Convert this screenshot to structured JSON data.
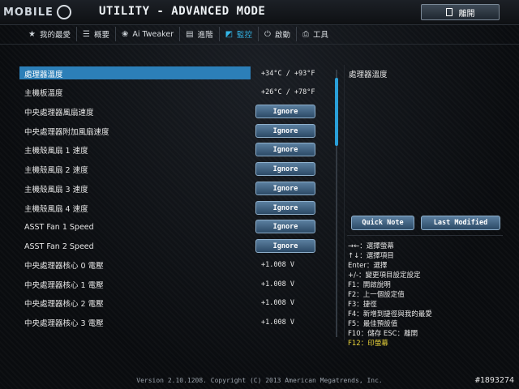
{
  "header": {
    "logo_text": "MOBILE",
    "title": "UTILITY - ADVANCED MODE",
    "exit_label": "離開"
  },
  "tabs": [
    {
      "icon": "star-icon",
      "glyph": "★",
      "label": "我的最愛",
      "active": false
    },
    {
      "icon": "list-icon",
      "glyph": "☰",
      "label": "概要",
      "active": false
    },
    {
      "icon": "tweaker-icon",
      "glyph": "❀",
      "label": "Ai Tweaker",
      "active": false
    },
    {
      "icon": "advanced-icon",
      "glyph": "▤",
      "label": "進階",
      "active": false
    },
    {
      "icon": "monitor-icon",
      "glyph": "◩",
      "label": "監控",
      "active": true
    },
    {
      "icon": "power-icon",
      "glyph": "⏻",
      "label": "啟動",
      "active": false
    },
    {
      "icon": "tool-icon",
      "glyph": "⎙",
      "label": "工具",
      "active": false
    }
  ],
  "rows": [
    {
      "label": "處理器溫度",
      "value": "+34°C / +93°F",
      "type": "text",
      "selected": true
    },
    {
      "label": "主機板溫度",
      "value": "+26°C / +78°F",
      "type": "text"
    },
    {
      "label": "中央處理器風扇速度",
      "value": "Ignore",
      "type": "button"
    },
    {
      "label": "中央處理器附加風扇速度",
      "value": "Ignore",
      "type": "button"
    },
    {
      "label": "主機殼風扇 1 速度",
      "value": "Ignore",
      "type": "button"
    },
    {
      "label": "主機殼風扇 2 速度",
      "value": "Ignore",
      "type": "button"
    },
    {
      "label": "主機殼風扇 3 速度",
      "value": "Ignore",
      "type": "button"
    },
    {
      "label": "主機殼風扇 4 速度",
      "value": "Ignore",
      "type": "button"
    },
    {
      "label": "ASST Fan 1 Speed",
      "value": "Ignore",
      "type": "button"
    },
    {
      "label": "ASST Fan 2 Speed",
      "value": "Ignore",
      "type": "button"
    },
    {
      "label": "中央處理器核心 0 電壓",
      "value": "+1.008 V",
      "type": "text"
    },
    {
      "label": "中央處理器核心 1 電壓",
      "value": "+1.008 V",
      "type": "text"
    },
    {
      "label": "中央處理器核心 2 電壓",
      "value": "+1.008 V",
      "type": "text"
    },
    {
      "label": "中央處理器核心 3 電壓",
      "value": "+1.008 V",
      "type": "text"
    }
  ],
  "help": {
    "title": "處理器溫度",
    "quick_note": "Quick Note",
    "last_modified": "Last Modified",
    "keys": [
      "→←：選擇螢幕",
      "↑↓：選擇項目",
      "Enter：選擇",
      "+/-：變更項目設定設定",
      "F1：開啟說明",
      "F2：上一個設定值",
      "F3：捷徑",
      "F4：新增到捷徑與我的最愛",
      "F5：最佳預設值",
      "F10：儲存  ESC：離開",
      "F12：印螢幕"
    ]
  },
  "footer": "Version 2.10.1208. Copyright (C) 2013 American Megatrends, Inc.",
  "watermark": "#1893274",
  "colors": {
    "accent": "#33b6e8",
    "selection": "#2c7fb8",
    "f12": "#e8d23a"
  }
}
